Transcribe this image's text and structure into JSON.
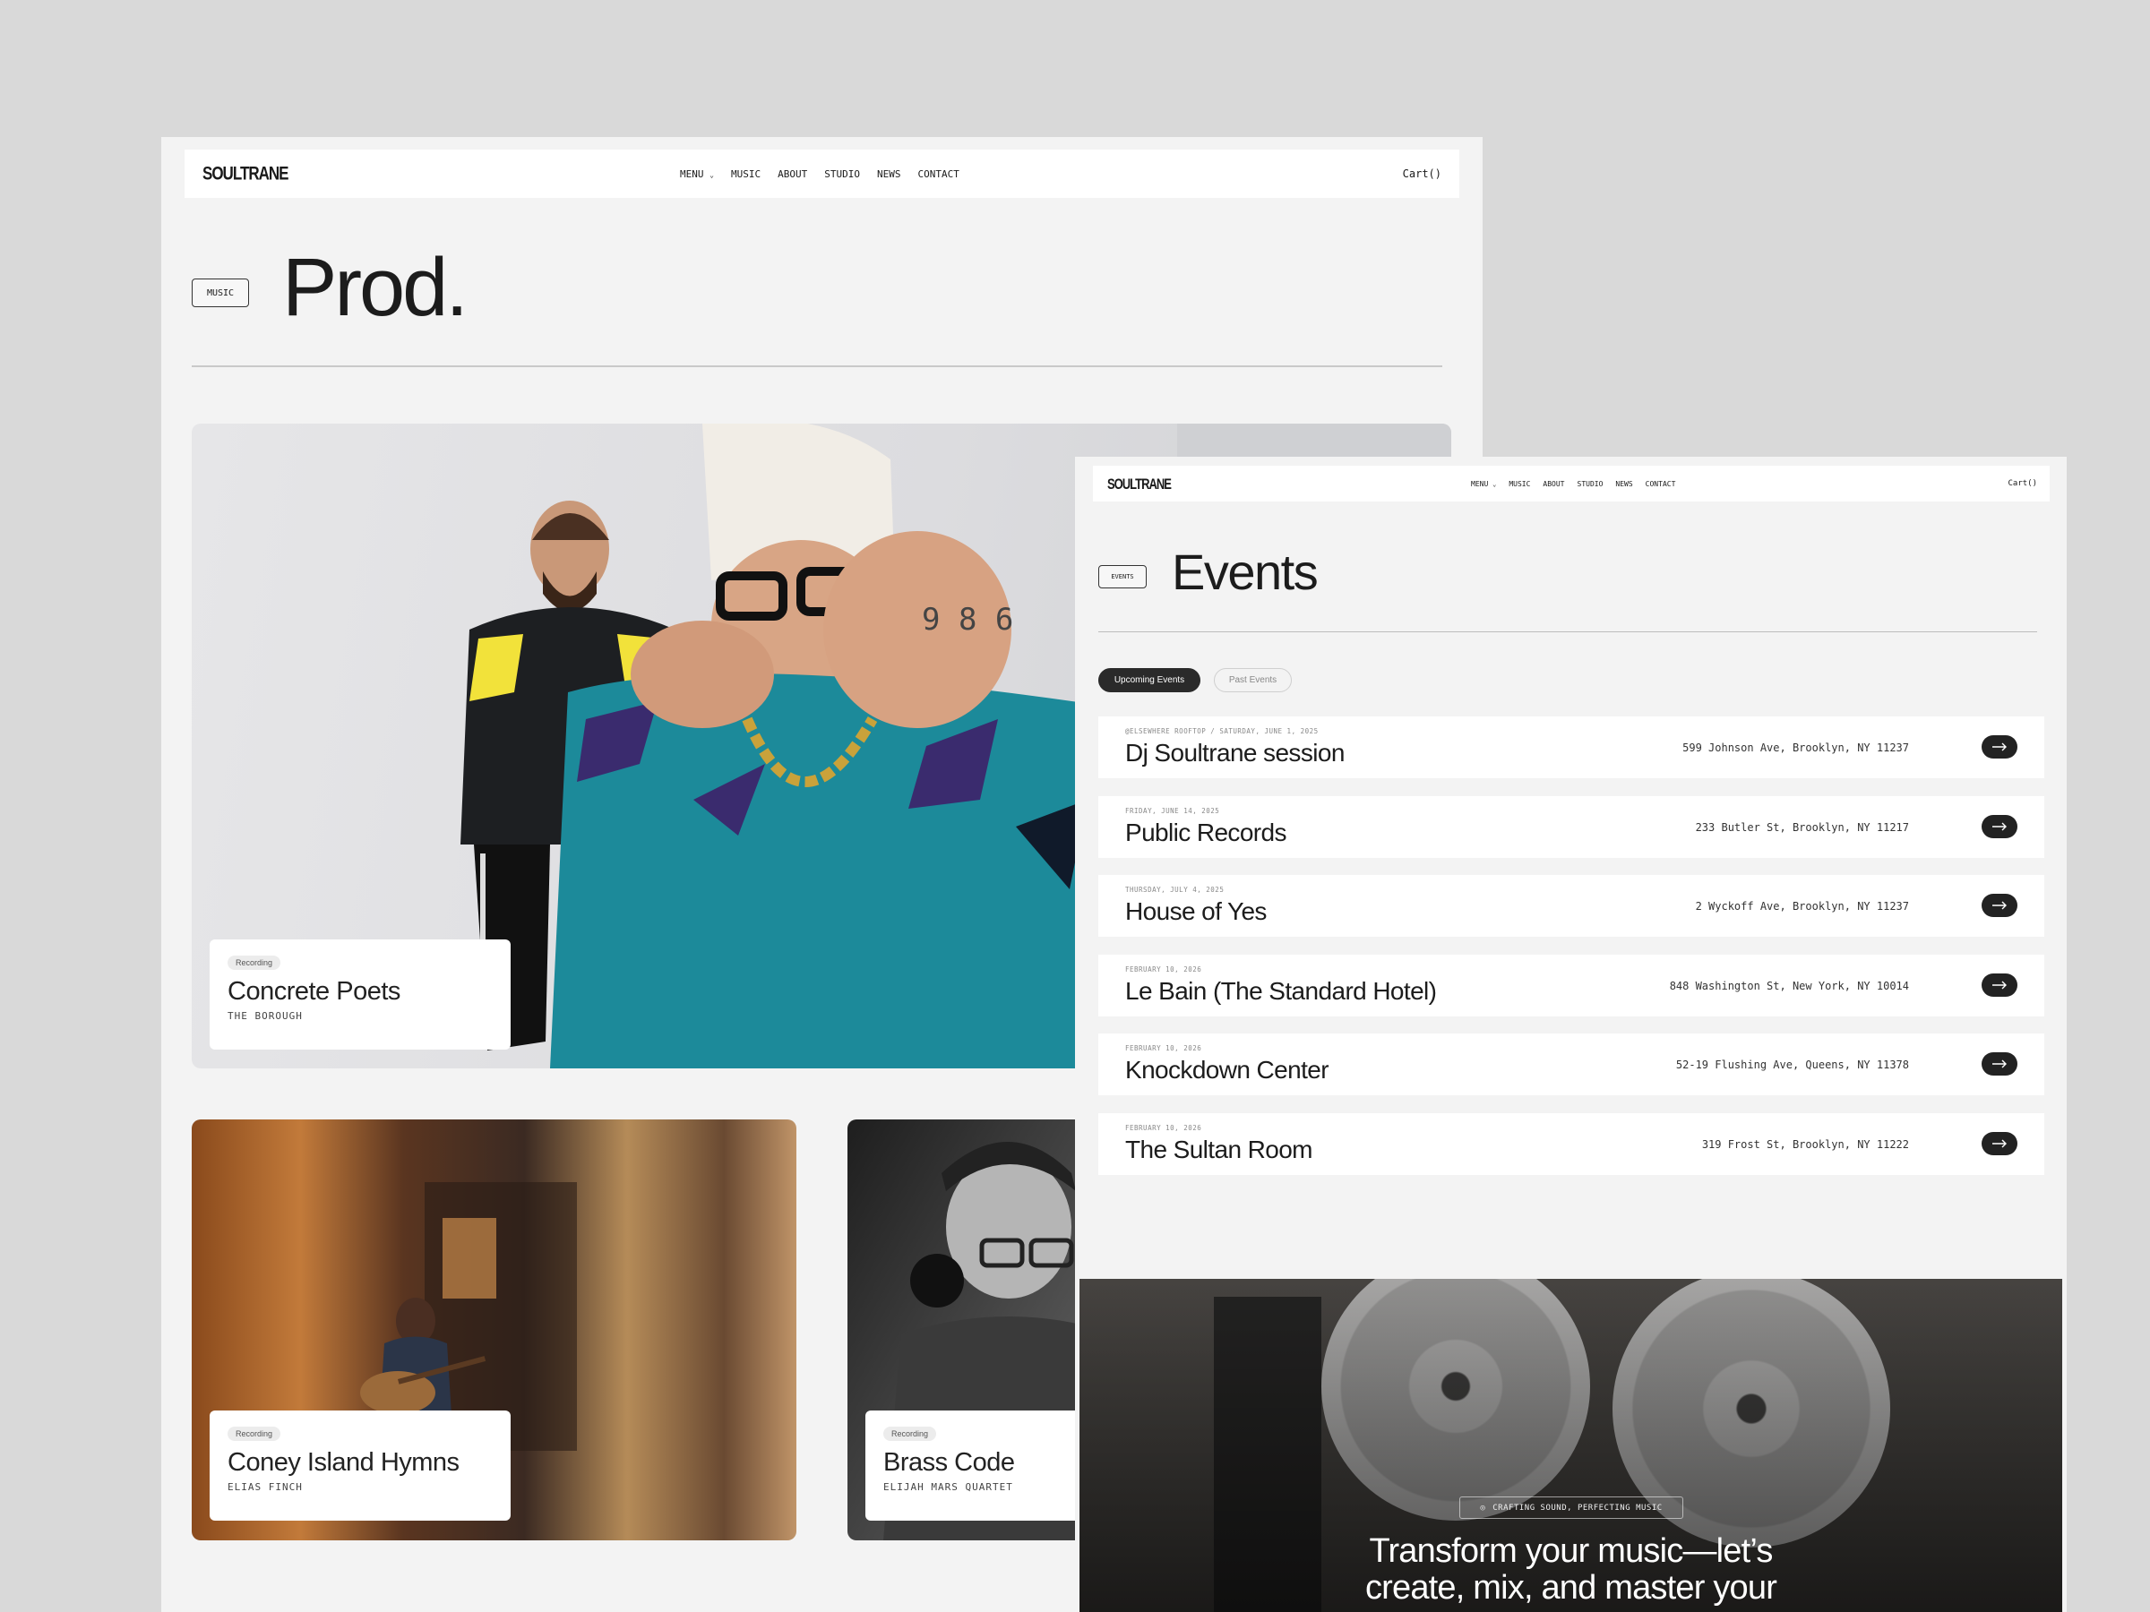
{
  "prod_page": {
    "logo": "SOULTRANE",
    "nav": [
      "MENU",
      "MUSIC",
      "ABOUT",
      "STUDIO",
      "NEWS",
      "CONTACT"
    ],
    "cart": "Cart()",
    "chip": "MUSIC",
    "title": "Prod.",
    "cards": [
      {
        "tag": "Recording",
        "title": "Concrete Poets",
        "subtitle": "THE BOROUGH"
      },
      {
        "tag": "Recording",
        "title": "Coney Island Hymns",
        "subtitle": "ELIAS FINCH"
      },
      {
        "tag": "Recording",
        "title": "Brass Code",
        "subtitle": "ELIJAH MARS QUARTET"
      }
    ]
  },
  "events_page": {
    "logo": "SOULTRANE",
    "nav": [
      "MENU",
      "MUSIC",
      "ABOUT",
      "STUDIO",
      "NEWS",
      "CONTACT"
    ],
    "cart": "Cart()",
    "chip": "EVENTS",
    "title": "Events",
    "tabs": [
      "Upcoming Events",
      "Past Events"
    ],
    "events": [
      {
        "date": "@ELSEWHERE ROOFTOP / SATURDAY, JUNE 1, 2025",
        "name": "Dj Soultrane session",
        "address": "599 Johnson Ave, Brooklyn, NY 11237"
      },
      {
        "date": "FRIDAY, JUNE 14, 2025",
        "name": "Public Records",
        "address": "233 Butler St, Brooklyn, NY 11217"
      },
      {
        "date": "THURSDAY, JULY 4, 2025",
        "name": "House of Yes",
        "address": "2 Wyckoff Ave, Brooklyn, NY 11237"
      },
      {
        "date": "FEBRUARY 10, 2026",
        "name": "Le Bain (The Standard Hotel)",
        "address": "848 Washington St, New York, NY 10014"
      },
      {
        "date": "FEBRUARY 10, 2026",
        "name": "Knockdown Center",
        "address": "52-19 Flushing Ave, Queens, NY 11378"
      },
      {
        "date": "FEBRUARY 10, 2026",
        "name": "The Sultan Room",
        "address": "319 Frost St, Brooklyn, NY 11222"
      }
    ],
    "cta_badge": "CRAFTING SOUND, PERFECTING MUSIC",
    "cta_line1": "Transform your music—let’s",
    "cta_line2": "create, mix, and master your"
  }
}
